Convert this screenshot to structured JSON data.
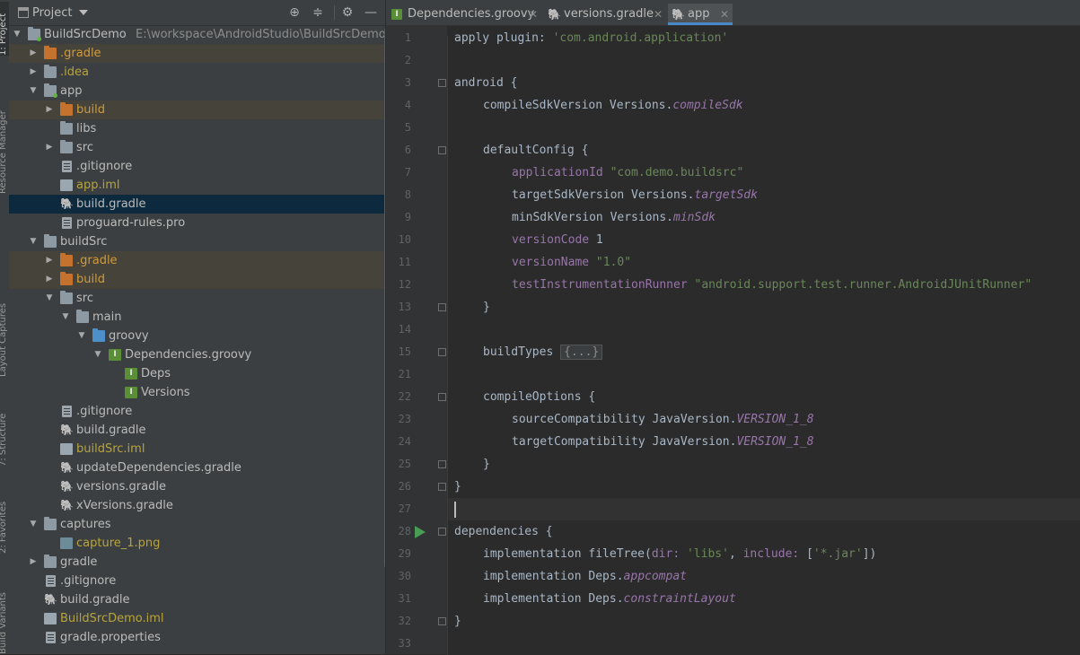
{
  "sidebar_strip": {
    "project_label": "1: Project",
    "resource_manager_label": "Resource Manager",
    "layout_captures_label": "Layout Captures",
    "structure_label": "7: Structure",
    "favorites_label": "2: Favorites",
    "build_variants_label": "Build Variants"
  },
  "project_panel": {
    "title": "Project",
    "tree": [
      {
        "label": "BuildSrcDemo",
        "path": "E:\\workspace\\AndroidStudio\\BuildSrcDemo",
        "depth": 0,
        "expand": "open",
        "icon": "module-folder-icon",
        "color": "normal"
      },
      {
        "label": ".gradle",
        "depth": 1,
        "expand": "closed",
        "icon": "folder-orange-icon",
        "color": "orange",
        "bg": "ignored"
      },
      {
        "label": ".idea",
        "depth": 1,
        "expand": "closed",
        "icon": "folder-gray-icon",
        "color": "olive"
      },
      {
        "label": "app",
        "depth": 1,
        "expand": "open",
        "icon": "module-folder-icon",
        "color": "normal"
      },
      {
        "label": "build",
        "depth": 2,
        "expand": "closed",
        "icon": "folder-orange-icon",
        "color": "orange",
        "bg": "ignored"
      },
      {
        "label": "libs",
        "depth": 2,
        "expand": "none",
        "icon": "folder-gray-icon",
        "color": "normal"
      },
      {
        "label": "src",
        "depth": 2,
        "expand": "closed",
        "icon": "folder-gray-icon",
        "color": "normal"
      },
      {
        "label": ".gitignore",
        "depth": 2,
        "expand": "none",
        "icon": "text-file-icon",
        "color": "normal"
      },
      {
        "label": "app.iml",
        "depth": 2,
        "expand": "none",
        "icon": "iml-file-icon",
        "color": "olive"
      },
      {
        "label": "build.gradle",
        "depth": 2,
        "expand": "none",
        "icon": "gradle-elephant-icon",
        "color": "normal",
        "bg": "selected"
      },
      {
        "label": "proguard-rules.pro",
        "depth": 2,
        "expand": "none",
        "icon": "text-file-icon",
        "color": "normal"
      },
      {
        "label": "buildSrc",
        "depth": 1,
        "expand": "open",
        "icon": "folder-gray-icon",
        "color": "normal"
      },
      {
        "label": ".gradle",
        "depth": 2,
        "expand": "closed",
        "icon": "folder-orange-icon",
        "color": "orange",
        "bg": "ignored"
      },
      {
        "label": "build",
        "depth": 2,
        "expand": "closed",
        "icon": "folder-orange-icon",
        "color": "orange",
        "bg": "ignored"
      },
      {
        "label": "src",
        "depth": 2,
        "expand": "open",
        "icon": "folder-gray-icon",
        "color": "normal"
      },
      {
        "label": "main",
        "depth": 3,
        "expand": "open",
        "icon": "folder-gray-icon",
        "color": "normal"
      },
      {
        "label": "groovy",
        "depth": 4,
        "expand": "open",
        "icon": "folder-blue-icon",
        "color": "normal"
      },
      {
        "label": "Dependencies.groovy",
        "depth": 5,
        "expand": "open",
        "icon": "groovy-class-icon",
        "color": "normal"
      },
      {
        "label": "Deps",
        "depth": 6,
        "expand": "none",
        "icon": "groovy-class-icon",
        "color": "normal"
      },
      {
        "label": "Versions",
        "depth": 6,
        "expand": "none",
        "icon": "groovy-class-icon",
        "color": "normal"
      },
      {
        "label": ".gitignore",
        "depth": 2,
        "expand": "none",
        "icon": "text-file-icon",
        "color": "normal"
      },
      {
        "label": "build.gradle",
        "depth": 2,
        "expand": "none",
        "icon": "gradle-elephant-icon",
        "color": "normal"
      },
      {
        "label": "buildSrc.iml",
        "depth": 2,
        "expand": "none",
        "icon": "iml-file-icon",
        "color": "olive"
      },
      {
        "label": "updateDependencies.gradle",
        "depth": 2,
        "expand": "none",
        "icon": "gradle-elephant-icon",
        "color": "normal"
      },
      {
        "label": "versions.gradle",
        "depth": 2,
        "expand": "none",
        "icon": "gradle-elephant-icon",
        "color": "normal"
      },
      {
        "label": "xVersions.gradle",
        "depth": 2,
        "expand": "none",
        "icon": "gradle-elephant-icon",
        "color": "normal"
      },
      {
        "label": "captures",
        "depth": 1,
        "expand": "open",
        "icon": "folder-gray-icon",
        "color": "normal"
      },
      {
        "label": "capture_1.png",
        "depth": 2,
        "expand": "none",
        "icon": "image-file-icon",
        "color": "olive"
      },
      {
        "label": "gradle",
        "depth": 1,
        "expand": "closed",
        "icon": "folder-gray-icon",
        "color": "normal"
      },
      {
        "label": ".gitignore",
        "depth": 1,
        "expand": "none",
        "icon": "text-file-icon",
        "color": "normal"
      },
      {
        "label": "build.gradle",
        "depth": 1,
        "expand": "none",
        "icon": "gradle-elephant-icon",
        "color": "normal"
      },
      {
        "label": "BuildSrcDemo.iml",
        "depth": 1,
        "expand": "none",
        "icon": "iml-file-icon",
        "color": "olive"
      },
      {
        "label": "gradle.properties",
        "depth": 1,
        "expand": "none",
        "icon": "properties-file-icon",
        "color": "normal"
      }
    ]
  },
  "editor": {
    "tabs": [
      {
        "label": "Dependencies.groovy",
        "icon": "groovy-class-icon",
        "active": false
      },
      {
        "label": "versions.gradle",
        "icon": "gradle-elephant-icon",
        "active": false
      },
      {
        "label": "app",
        "icon": "gradle-elephant-icon",
        "active": true
      }
    ],
    "lines": [
      {
        "n": "1",
        "indent": 0,
        "parts": [
          [
            "t",
            "apply plugin: "
          ],
          [
            "s",
            "'com.android.application'"
          ]
        ]
      },
      {
        "n": "2",
        "indent": 0,
        "parts": []
      },
      {
        "n": "3",
        "indent": 0,
        "fold": true,
        "parts": [
          [
            "t",
            "android {"
          ]
        ]
      },
      {
        "n": "4",
        "indent": 1,
        "parts": [
          [
            "t",
            "compileSdkVersion Versions."
          ],
          [
            "p",
            "compileSdk"
          ]
        ]
      },
      {
        "n": "5",
        "indent": 0,
        "parts": []
      },
      {
        "n": "6",
        "indent": 1,
        "fold": true,
        "parts": [
          [
            "t",
            "defaultConfig {"
          ]
        ]
      },
      {
        "n": "7",
        "indent": 2,
        "parts": [
          [
            "p2",
            "applicationId "
          ],
          [
            "s",
            "\"com.demo.buildsrc\""
          ]
        ]
      },
      {
        "n": "8",
        "indent": 2,
        "parts": [
          [
            "t",
            "targetSdkVersion Versions."
          ],
          [
            "p",
            "targetSdk"
          ]
        ]
      },
      {
        "n": "9",
        "indent": 2,
        "parts": [
          [
            "t",
            "minSdkVersion Versions."
          ],
          [
            "p",
            "minSdk"
          ]
        ]
      },
      {
        "n": "10",
        "indent": 2,
        "parts": [
          [
            "p2",
            "versionCode "
          ],
          [
            "t",
            "1"
          ]
        ]
      },
      {
        "n": "11",
        "indent": 2,
        "parts": [
          [
            "p2",
            "versionName "
          ],
          [
            "s",
            "\"1.0\""
          ]
        ]
      },
      {
        "n": "12",
        "indent": 2,
        "parts": [
          [
            "p2",
            "testInstrumentationRunner "
          ],
          [
            "s",
            "\"android.support.test.runner.AndroidJUnitRunner\""
          ]
        ]
      },
      {
        "n": "13",
        "indent": 1,
        "fold": true,
        "parts": [
          [
            "t",
            "}"
          ]
        ]
      },
      {
        "n": "14",
        "indent": 0,
        "parts": []
      },
      {
        "n": "15",
        "indent": 1,
        "fold": true,
        "parts": [
          [
            "t",
            "buildTypes "
          ],
          [
            "c",
            "{...}"
          ]
        ]
      },
      {
        "n": "21",
        "indent": 0,
        "parts": []
      },
      {
        "n": "22",
        "indent": 1,
        "fold": true,
        "parts": [
          [
            "t",
            "compileOptions {"
          ]
        ]
      },
      {
        "n": "23",
        "indent": 2,
        "parts": [
          [
            "t",
            "sourceCompatibility JavaVersion."
          ],
          [
            "p",
            "VERSION_1_8"
          ]
        ]
      },
      {
        "n": "24",
        "indent": 2,
        "parts": [
          [
            "t",
            "targetCompatibility JavaVersion."
          ],
          [
            "p",
            "VERSION_1_8"
          ]
        ]
      },
      {
        "n": "25",
        "indent": 1,
        "fold": true,
        "parts": [
          [
            "t",
            "}"
          ]
        ]
      },
      {
        "n": "26",
        "indent": 0,
        "fold": true,
        "parts": [
          [
            "t",
            "}"
          ]
        ]
      },
      {
        "n": "27",
        "indent": 0,
        "current": true,
        "parts": []
      },
      {
        "n": "28",
        "indent": 0,
        "fold": true,
        "run": true,
        "parts": [
          [
            "t",
            "dependencies {"
          ]
        ]
      },
      {
        "n": "29",
        "indent": 1,
        "parts": [
          [
            "t",
            "implementation fileTree("
          ],
          [
            "p2",
            "dir: "
          ],
          [
            "s",
            "'libs'"
          ],
          [
            "t",
            ", "
          ],
          [
            "p2",
            "include: "
          ],
          [
            "t",
            "["
          ],
          [
            "s",
            "'*.jar'"
          ],
          [
            "t",
            "])"
          ]
        ]
      },
      {
        "n": "30",
        "indent": 1,
        "parts": [
          [
            "t",
            "implementation Deps."
          ],
          [
            "p",
            "appcompat"
          ]
        ]
      },
      {
        "n": "31",
        "indent": 1,
        "parts": [
          [
            "t",
            "implementation Deps."
          ],
          [
            "p",
            "constraintLayout"
          ]
        ]
      },
      {
        "n": "32",
        "indent": 0,
        "fold": true,
        "parts": [
          [
            "t",
            "}"
          ]
        ]
      },
      {
        "n": "33",
        "indent": 0,
        "parts": []
      }
    ]
  }
}
